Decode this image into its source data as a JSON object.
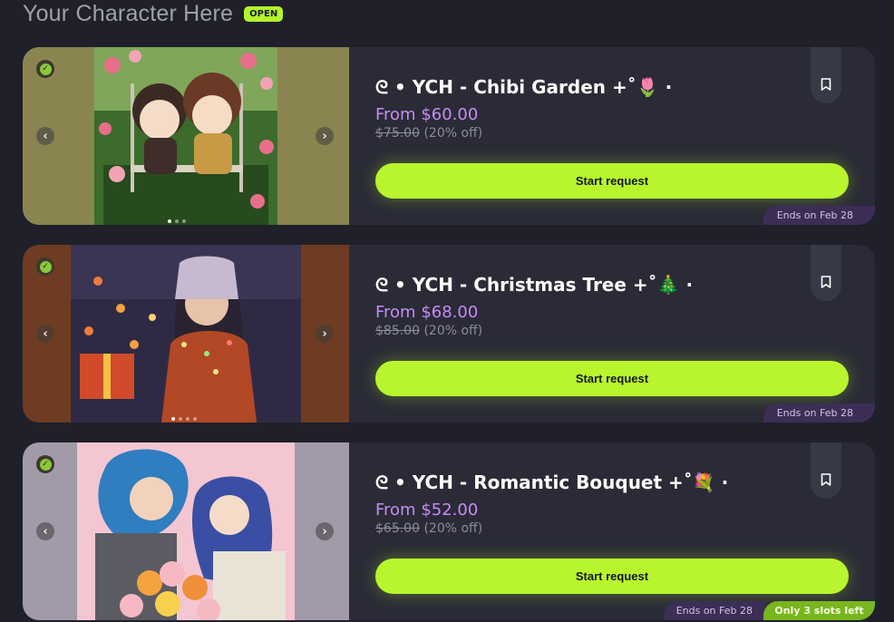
{
  "header": {
    "title": "Your Character Here",
    "badge": "OPEN"
  },
  "colors": {
    "accent": "#b8f52c",
    "price": "#c78bf5",
    "ends_tag": "#3c2e57",
    "slots_tag": "#78b61e"
  },
  "cards": [
    {
      "title": "ᘓ • YCH - Chibi Garden +˚🌷 ·",
      "price": "From $60.00",
      "old_price": "$75.00",
      "discount": "(20% off)",
      "button": "Start request",
      "ends": "Ends on Feb 28",
      "icons": [
        "verified-badge-icon",
        "chevron-left-icon",
        "chevron-right-icon",
        "bookmark-icon"
      ]
    },
    {
      "title": "ᘓ • YCH - Christmas Tree +˚🎄 ·",
      "price": "From $68.00",
      "old_price": "$85.00",
      "discount": "(20% off)",
      "button": "Start request",
      "ends": "Ends on Feb 28",
      "icons": [
        "verified-badge-icon",
        "chevron-left-icon",
        "chevron-right-icon",
        "bookmark-icon"
      ]
    },
    {
      "title": "ᘓ • YCH - Romantic Bouquet +˚💐 ·",
      "price": "From $52.00",
      "old_price": "$65.00",
      "discount": "(20% off)",
      "button": "Start request",
      "ends": "Ends on Feb 28",
      "slots": "Only 3 slots left",
      "icons": [
        "verified-badge-icon",
        "chevron-left-icon",
        "chevron-right-icon",
        "bookmark-icon"
      ]
    }
  ]
}
